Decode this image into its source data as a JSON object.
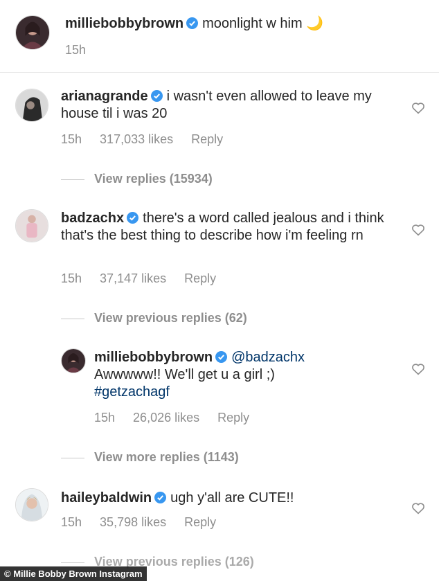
{
  "post": {
    "username": "milliebobbybrown",
    "caption": "moonlight w him",
    "caption_emoji": "🌙",
    "time": "15h"
  },
  "comments": [
    {
      "username": "arianagrande",
      "text": "i wasn't even allowed to leave my house til i was 20",
      "time": "15h",
      "likes": "317,033 likes",
      "reply": "Reply",
      "view_replies": "View replies (15934)"
    },
    {
      "username": "badzachx",
      "text": "there's a word called jealous and i think that's the best thing to describe how i'm feeling rn",
      "time": "15h",
      "likes": "37,147 likes",
      "reply": "Reply",
      "view_replies": "View previous replies (62)"
    },
    {
      "username": "milliebobbybrown",
      "mention": "@badzachx",
      "text": "Awwwww!! We'll get u a girl ;)",
      "hashtag": "#getzachagf",
      "time": "15h",
      "likes": "26,026 likes",
      "reply": "Reply",
      "view_replies": "View more replies (1143)"
    },
    {
      "username": "haileybaldwin",
      "text": "ugh y'all are CUTE!!",
      "time": "15h",
      "likes": "35,798 likes",
      "reply": "Reply",
      "view_replies": "View previous replies (126)"
    }
  ],
  "footer": {
    "credit": "© Millie Bobby Brown Instagram"
  },
  "colors": {
    "verified": "#3897f0",
    "meta": "#8e8e8e",
    "text": "#262626"
  }
}
